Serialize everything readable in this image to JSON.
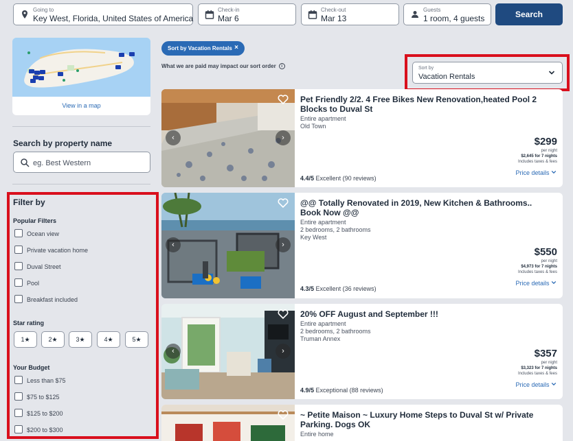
{
  "search": {
    "going_to": {
      "label": "Going to",
      "value": "Key West, Florida, United States of America"
    },
    "check_in": {
      "label": "Check-in",
      "value": "Mar 6"
    },
    "check_out": {
      "label": "Check-out",
      "value": "Mar 13"
    },
    "guests": {
      "label": "Guests",
      "value": "1 room, 4 guests"
    },
    "button": "Search"
  },
  "sidebar": {
    "map_link": "View in a map",
    "name_search": {
      "heading": "Search by property name",
      "placeholder": "eg. Best Western"
    },
    "filter_heading": "Filter by",
    "popular": {
      "heading": "Popular Filters",
      "items": [
        "Ocean view",
        "Private vacation home",
        "Duval Street",
        "Pool",
        "Breakfast included"
      ]
    },
    "star": {
      "heading": "Star rating",
      "items": [
        "1★",
        "2★",
        "3★",
        "4★",
        "5★"
      ]
    },
    "budget": {
      "heading": "Your Budget",
      "items": [
        "Less than $75",
        "$75 to $125",
        "$125 to $200",
        "$200 to $300"
      ]
    }
  },
  "results": {
    "chip": "Sort by Vacation Rentals",
    "chip_close": "×",
    "note": "What we are paid may impact our sort order",
    "sort": {
      "label": "Sort by",
      "value": "Vacation Rentals"
    },
    "listings": [
      {
        "title": "Pet Friendly 2/2. 4 Free Bikes New Renovation,heated Pool 2 Blocks to Duval St",
        "type": "Entire apartment",
        "rooms": "",
        "location": "Old Town",
        "price": "$299",
        "per_night": "per night",
        "total": "$2,645 for 7 nights",
        "taxes": "Includes taxes & fees",
        "details": "Price details",
        "score": "4.4/5",
        "rating_text": "Excellent (90 reviews)"
      },
      {
        "title": "@@ Totally Renovated in 2019, New Kitchen & Bathrooms.. Book Now @@",
        "type": "Entire apartment",
        "rooms": "2 bedrooms, 2 bathrooms",
        "location": "Key West",
        "price": "$550",
        "per_night": "per night",
        "total": "$4,973 for 7 nights",
        "taxes": "Includes taxes & fees",
        "details": "Price details",
        "score": "4.3/5",
        "rating_text": "Excellent (36 reviews)"
      },
      {
        "title": "20% OFF August and September !!!",
        "type": "Entire apartment",
        "rooms": "2 bedrooms, 2 bathrooms",
        "location": "Truman Annex",
        "price": "$357",
        "per_night": "per night",
        "total": "$3,323 for 7 nights",
        "taxes": "Includes taxes & fees",
        "details": "Price details",
        "score": "4.9/5",
        "rating_text": "Exceptional (88 reviews)"
      },
      {
        "title": "~ Petite Maison ~ Luxury Home Steps to Duval St w/ Private Parking. Dogs OK",
        "type": "Entire home",
        "rooms": "",
        "location": ""
      }
    ]
  },
  "colors": {
    "primary": "#1f4a80",
    "link": "#2a6ab5",
    "highlight": "#d90f1c"
  }
}
